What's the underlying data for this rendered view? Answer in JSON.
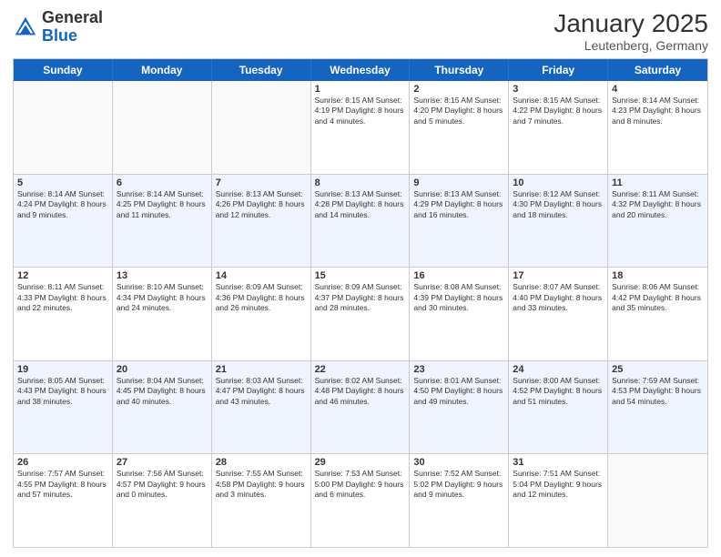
{
  "header": {
    "logo_general": "General",
    "logo_blue": "Blue",
    "month_title": "January 2025",
    "subtitle": "Leutenberg, Germany"
  },
  "day_headers": [
    "Sunday",
    "Monday",
    "Tuesday",
    "Wednesday",
    "Thursday",
    "Friday",
    "Saturday"
  ],
  "weeks": [
    [
      {
        "num": "",
        "info": ""
      },
      {
        "num": "",
        "info": ""
      },
      {
        "num": "",
        "info": ""
      },
      {
        "num": "1",
        "info": "Sunrise: 8:15 AM\nSunset: 4:19 PM\nDaylight: 8 hours\nand 4 minutes."
      },
      {
        "num": "2",
        "info": "Sunrise: 8:15 AM\nSunset: 4:20 PM\nDaylight: 8 hours\nand 5 minutes."
      },
      {
        "num": "3",
        "info": "Sunrise: 8:15 AM\nSunset: 4:22 PM\nDaylight: 8 hours\nand 7 minutes."
      },
      {
        "num": "4",
        "info": "Sunrise: 8:14 AM\nSunset: 4:23 PM\nDaylight: 8 hours\nand 8 minutes."
      }
    ],
    [
      {
        "num": "5",
        "info": "Sunrise: 8:14 AM\nSunset: 4:24 PM\nDaylight: 8 hours\nand 9 minutes."
      },
      {
        "num": "6",
        "info": "Sunrise: 8:14 AM\nSunset: 4:25 PM\nDaylight: 8 hours\nand 11 minutes."
      },
      {
        "num": "7",
        "info": "Sunrise: 8:13 AM\nSunset: 4:26 PM\nDaylight: 8 hours\nand 12 minutes."
      },
      {
        "num": "8",
        "info": "Sunrise: 8:13 AM\nSunset: 4:28 PM\nDaylight: 8 hours\nand 14 minutes."
      },
      {
        "num": "9",
        "info": "Sunrise: 8:13 AM\nSunset: 4:29 PM\nDaylight: 8 hours\nand 16 minutes."
      },
      {
        "num": "10",
        "info": "Sunrise: 8:12 AM\nSunset: 4:30 PM\nDaylight: 8 hours\nand 18 minutes."
      },
      {
        "num": "11",
        "info": "Sunrise: 8:11 AM\nSunset: 4:32 PM\nDaylight: 8 hours\nand 20 minutes."
      }
    ],
    [
      {
        "num": "12",
        "info": "Sunrise: 8:11 AM\nSunset: 4:33 PM\nDaylight: 8 hours\nand 22 minutes."
      },
      {
        "num": "13",
        "info": "Sunrise: 8:10 AM\nSunset: 4:34 PM\nDaylight: 8 hours\nand 24 minutes."
      },
      {
        "num": "14",
        "info": "Sunrise: 8:09 AM\nSunset: 4:36 PM\nDaylight: 8 hours\nand 26 minutes."
      },
      {
        "num": "15",
        "info": "Sunrise: 8:09 AM\nSunset: 4:37 PM\nDaylight: 8 hours\nand 28 minutes."
      },
      {
        "num": "16",
        "info": "Sunrise: 8:08 AM\nSunset: 4:39 PM\nDaylight: 8 hours\nand 30 minutes."
      },
      {
        "num": "17",
        "info": "Sunrise: 8:07 AM\nSunset: 4:40 PM\nDaylight: 8 hours\nand 33 minutes."
      },
      {
        "num": "18",
        "info": "Sunrise: 8:06 AM\nSunset: 4:42 PM\nDaylight: 8 hours\nand 35 minutes."
      }
    ],
    [
      {
        "num": "19",
        "info": "Sunrise: 8:05 AM\nSunset: 4:43 PM\nDaylight: 8 hours\nand 38 minutes."
      },
      {
        "num": "20",
        "info": "Sunrise: 8:04 AM\nSunset: 4:45 PM\nDaylight: 8 hours\nand 40 minutes."
      },
      {
        "num": "21",
        "info": "Sunrise: 8:03 AM\nSunset: 4:47 PM\nDaylight: 8 hours\nand 43 minutes."
      },
      {
        "num": "22",
        "info": "Sunrise: 8:02 AM\nSunset: 4:48 PM\nDaylight: 8 hours\nand 46 minutes."
      },
      {
        "num": "23",
        "info": "Sunrise: 8:01 AM\nSunset: 4:50 PM\nDaylight: 8 hours\nand 49 minutes."
      },
      {
        "num": "24",
        "info": "Sunrise: 8:00 AM\nSunset: 4:52 PM\nDaylight: 8 hours\nand 51 minutes."
      },
      {
        "num": "25",
        "info": "Sunrise: 7:59 AM\nSunset: 4:53 PM\nDaylight: 8 hours\nand 54 minutes."
      }
    ],
    [
      {
        "num": "26",
        "info": "Sunrise: 7:57 AM\nSunset: 4:55 PM\nDaylight: 8 hours\nand 57 minutes."
      },
      {
        "num": "27",
        "info": "Sunrise: 7:56 AM\nSunset: 4:57 PM\nDaylight: 9 hours\nand 0 minutes."
      },
      {
        "num": "28",
        "info": "Sunrise: 7:55 AM\nSunset: 4:58 PM\nDaylight: 9 hours\nand 3 minutes."
      },
      {
        "num": "29",
        "info": "Sunrise: 7:53 AM\nSunset: 5:00 PM\nDaylight: 9 hours\nand 6 minutes."
      },
      {
        "num": "30",
        "info": "Sunrise: 7:52 AM\nSunset: 5:02 PM\nDaylight: 9 hours\nand 9 minutes."
      },
      {
        "num": "31",
        "info": "Sunrise: 7:51 AM\nSunset: 5:04 PM\nDaylight: 9 hours\nand 12 minutes."
      },
      {
        "num": "",
        "info": ""
      }
    ]
  ]
}
